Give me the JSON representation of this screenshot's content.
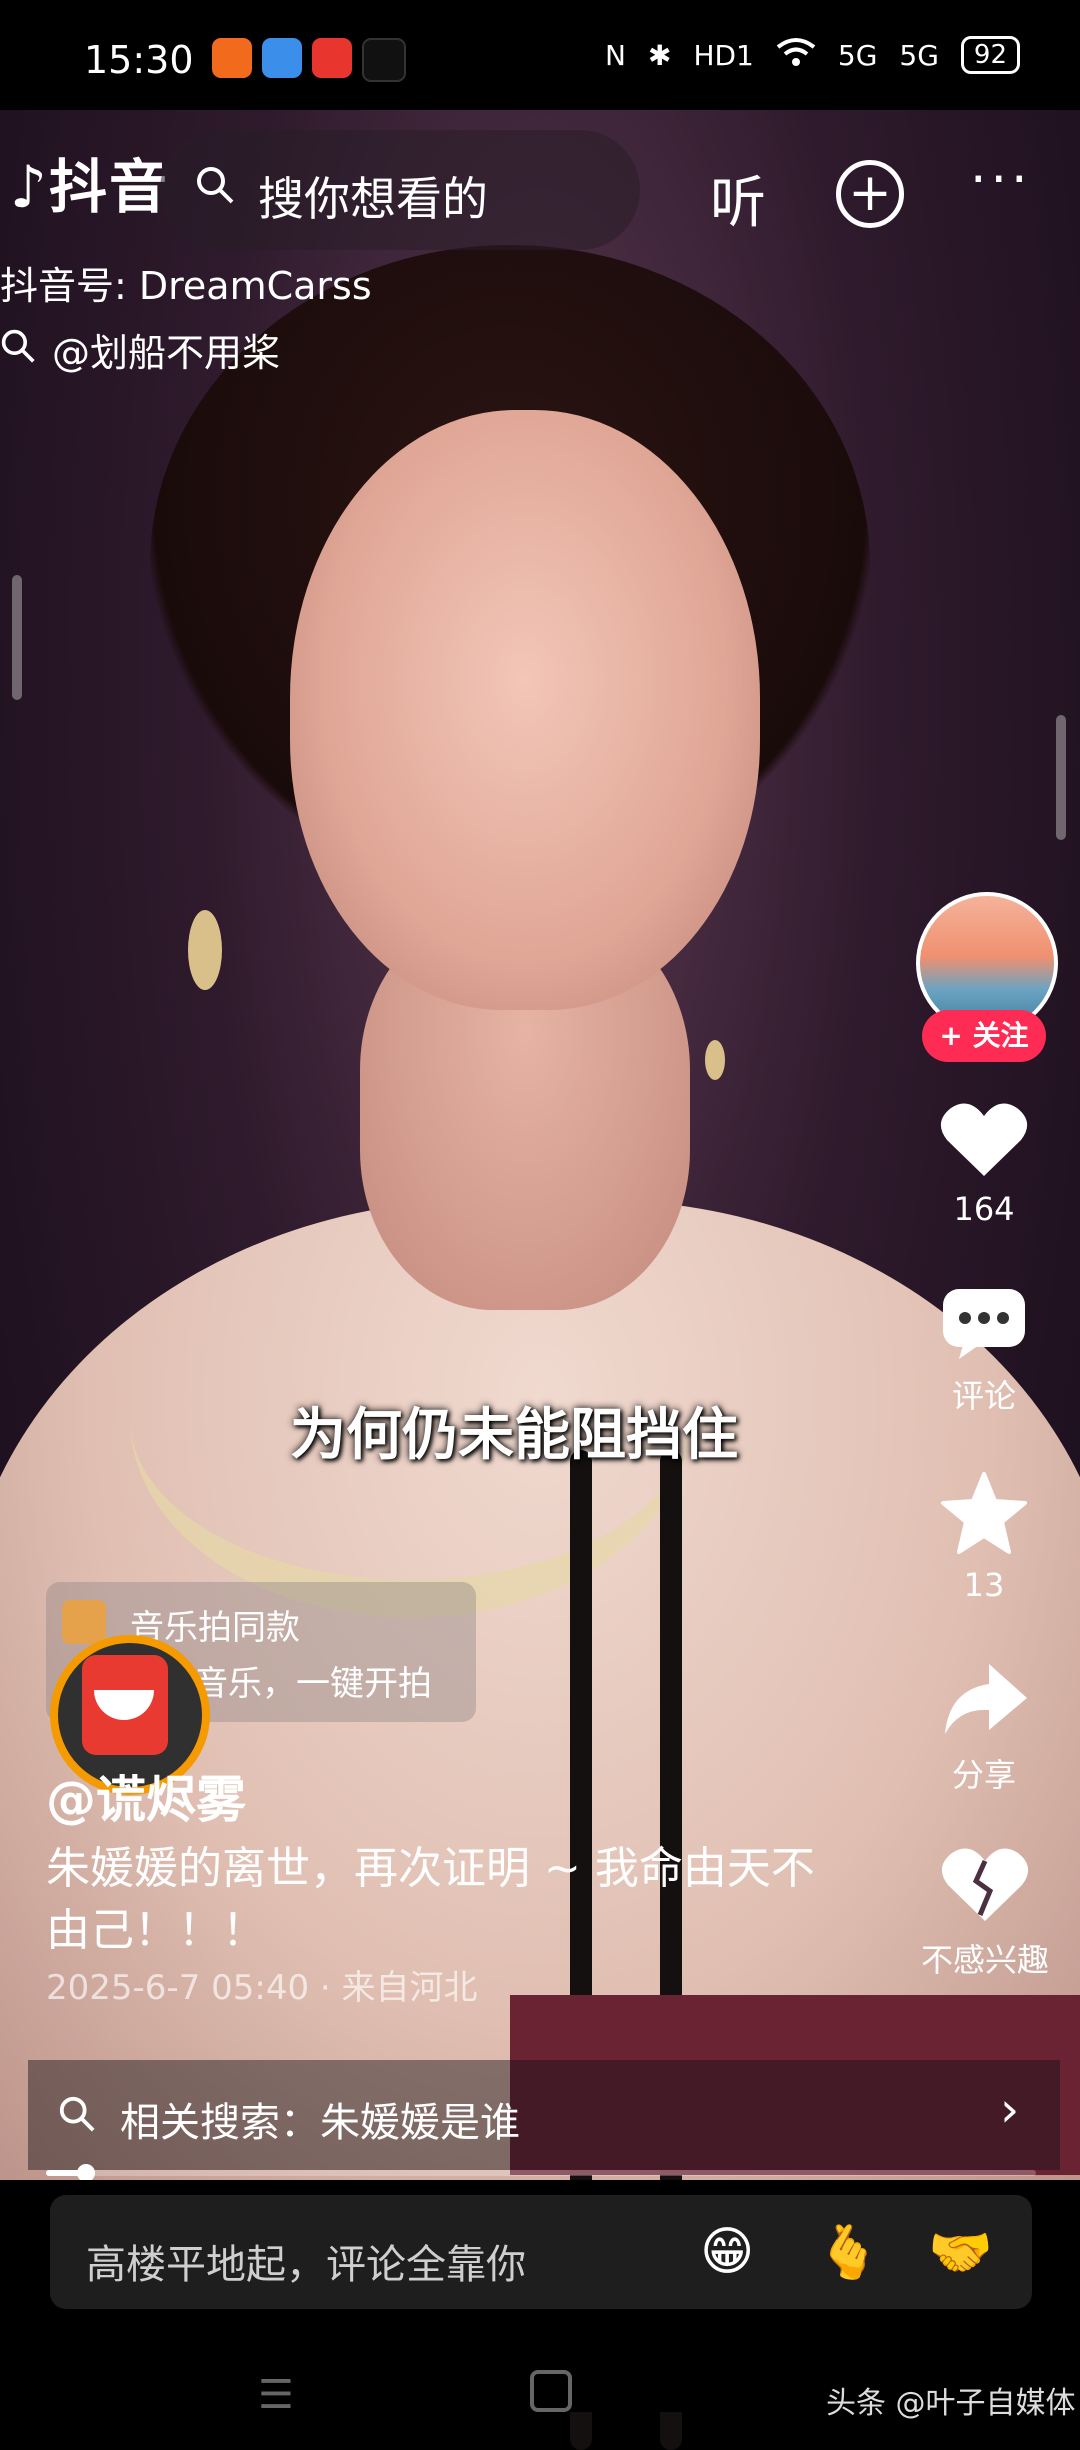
{
  "status_bar": {
    "time": "15:30",
    "battery": "92",
    "signal_1": "5G",
    "signal_2": "5G",
    "hd": "HD1"
  },
  "top_bar": {
    "app_name": "抖音",
    "search_placeholder": "搜你想看的",
    "listen_label": "听",
    "add_label": "+",
    "more_label": "···"
  },
  "watermark": {
    "douyin_id": "抖音号: DreamCarss",
    "user": "@划船不用桨"
  },
  "video": {
    "subtitle": "为何仍未能阻挡住"
  },
  "actions": {
    "follow_label": "+ 关注",
    "like_count": "164",
    "comment_label": "评论",
    "favorite_count": "13",
    "share_label": "分享",
    "dislike_label": "不感兴趣"
  },
  "music": {
    "title": "音乐拍同款",
    "subtitle": "音乐，一键开拍"
  },
  "post": {
    "author": "@谎烬雾",
    "caption": "朱媛媛的离世，再次证明 ~ 我命由天不由己！！！",
    "time": "2025-6-7 05:40 · 来自河北"
  },
  "related": {
    "text": "相关搜索：朱媛媛是谁",
    "chevron": "›"
  },
  "comment_bar": {
    "placeholder": "高楼平地起，评论全靠你",
    "emojis": [
      "😁",
      "🫰",
      "🤝"
    ]
  },
  "footer": {
    "watermark": "头条 @叶子自媒体"
  },
  "colors": {
    "accent": "#fe2c55",
    "redpacket": "#e93a31",
    "ring": "#f59a00"
  },
  "progress": {
    "fraction": 0.04
  }
}
